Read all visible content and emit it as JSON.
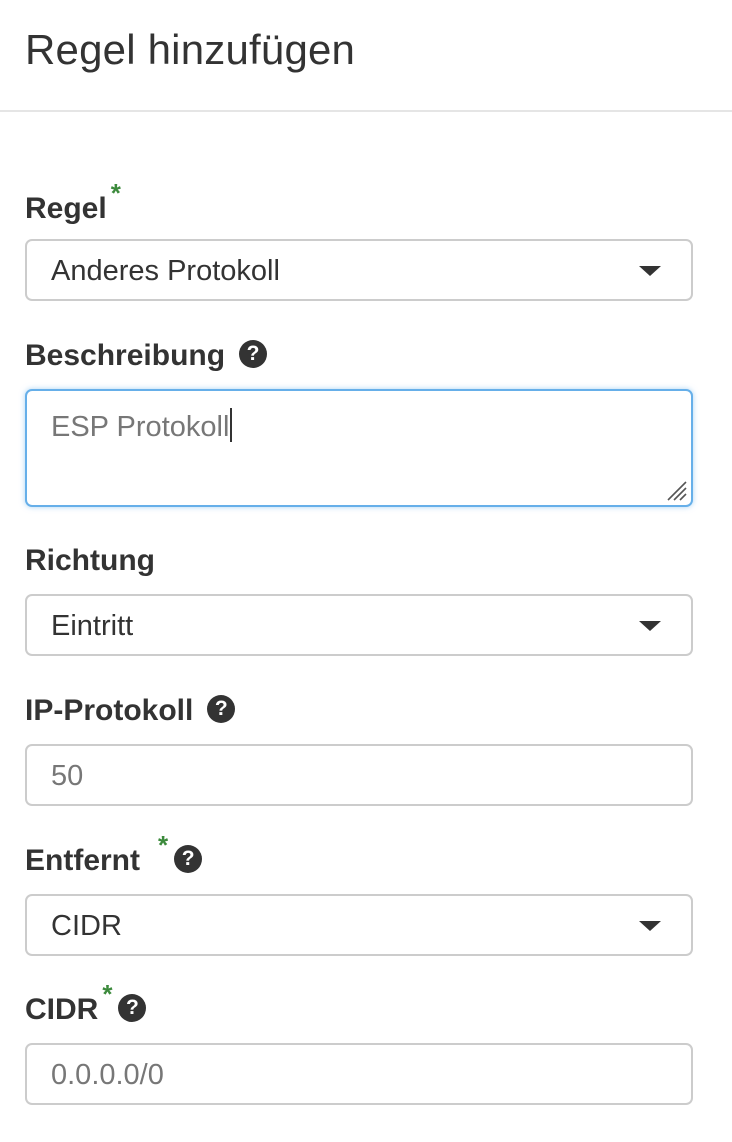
{
  "header": {
    "title": "Regel hinzufügen"
  },
  "form": {
    "rule": {
      "label": "Regel",
      "required_mark": "*",
      "value": "Anderes Protokoll"
    },
    "description": {
      "label": "Beschreibung",
      "help": "?",
      "value": "ESP Protokoll"
    },
    "direction": {
      "label": "Richtung",
      "value": "Eintritt"
    },
    "ip_protocol": {
      "label": "IP-Protokoll",
      "help": "?",
      "placeholder": "50"
    },
    "remote": {
      "label": "Entfernt",
      "required_mark": "*",
      "help": "?",
      "value": "CIDR"
    },
    "cidr": {
      "label": "CIDR",
      "required_mark": "*",
      "help": "?",
      "placeholder": "0.0.0.0/0"
    }
  },
  "icons": {
    "dropdown": "caret-down-icon",
    "help": "question-circle-icon",
    "resize": "resize-handle-icon"
  },
  "colors": {
    "required": "#3c8a3c",
    "focus_border": "#66afe9",
    "text": "#333333",
    "placeholder": "#777777",
    "border": "#cccccc"
  }
}
